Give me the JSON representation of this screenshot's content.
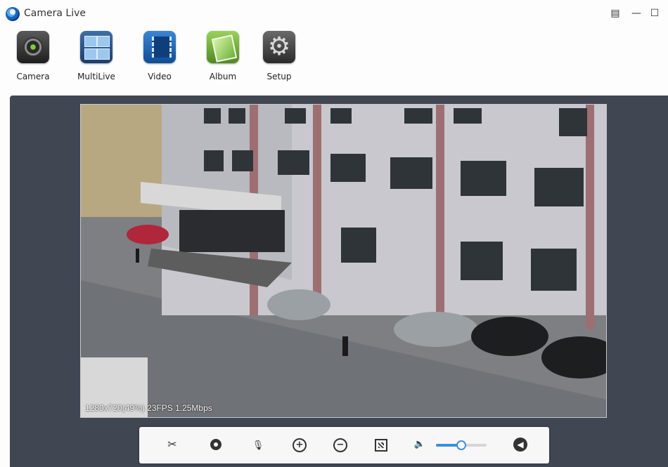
{
  "app": {
    "title": "Camera Live",
    "window_controls": {
      "menu": "▤",
      "minimize": "—",
      "maximize": "☐"
    }
  },
  "toolbar": {
    "items": [
      {
        "label": "Camera",
        "icon": "camera-icon"
      },
      {
        "label": "MultiLive",
        "icon": "multilive-icon"
      },
      {
        "label": "Video",
        "icon": "video-icon"
      },
      {
        "label": "Album",
        "icon": "album-icon"
      },
      {
        "label": "Setup",
        "icon": "gear-icon"
      }
    ]
  },
  "video": {
    "status_text": "1280x720(49%)  23FPS 1.25Mbps"
  },
  "controls": {
    "icons": {
      "snapshot": "✂",
      "mic": "🎙",
      "zoom_in": "+",
      "zoom_out": "−",
      "volume": "🔈",
      "back": "◀"
    },
    "volume_level": 0.5
  },
  "colors": {
    "main_background": "#404652",
    "accent": "#3c8fd8"
  }
}
